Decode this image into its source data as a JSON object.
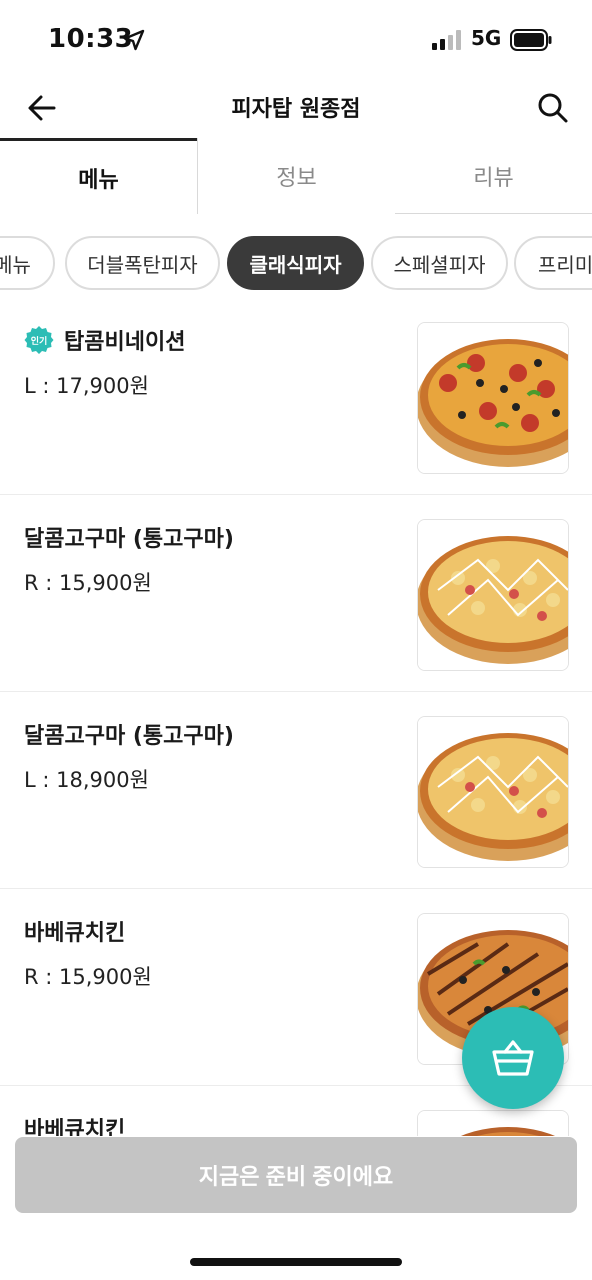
{
  "status_bar": {
    "time": "10:33",
    "network": "5G",
    "icons": [
      "location-arrow-icon",
      "signal-icon",
      "battery-icon"
    ]
  },
  "header": {
    "title": "피자탑 원종점",
    "back_icon": "back-arrow-icon",
    "search_icon": "search-icon"
  },
  "tabs": [
    {
      "label": "메뉴",
      "active": true
    },
    {
      "label": "정보",
      "active": false
    },
    {
      "label": "리뷰",
      "active": false
    }
  ],
  "categories": [
    {
      "label": "메뉴",
      "active": false
    },
    {
      "label": "더블폭탄피자",
      "active": false
    },
    {
      "label": "클래식피자",
      "active": true
    },
    {
      "label": "스페셜피자",
      "active": false
    },
    {
      "label": "프리미",
      "active": false
    }
  ],
  "menu_items": [
    {
      "badge": "인기",
      "name": "탑콤비네이션",
      "price": "L : 17,900원"
    },
    {
      "badge": "",
      "name": "달콤고구마 (통고구마)",
      "price": "R : 15,900원"
    },
    {
      "badge": "",
      "name": "달콤고구마 (통고구마)",
      "price": "L : 18,900원"
    },
    {
      "badge": "",
      "name": "바베큐치킨",
      "price": "R : 15,900원"
    },
    {
      "badge": "",
      "name": "바베큐치킨",
      "price": ""
    }
  ],
  "cart_icon": "basket-icon",
  "cta": {
    "label": "지금은 준비 중이에요"
  },
  "colors": {
    "accent": "#2cbdb5",
    "active_chip": "#3a3a3a",
    "disabled_button": "#c4c4c4"
  }
}
